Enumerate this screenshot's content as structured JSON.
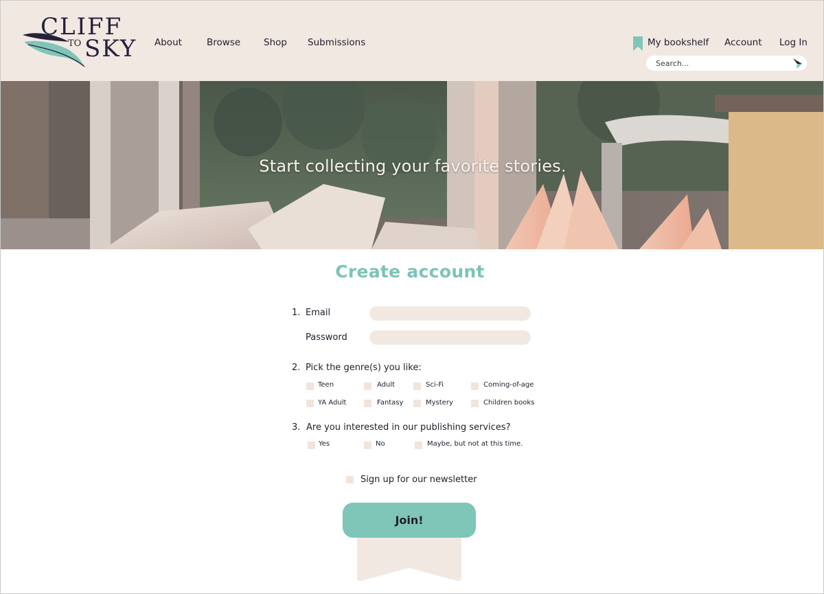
{
  "brand": {
    "line1": "CLIFF",
    "line2": "TO",
    "line3": "SKY"
  },
  "colors": {
    "header_bg": "#f2e8e2",
    "accent": "#7fc5b8",
    "title": "#7cc4b7",
    "field_bg": "#f2e8e2",
    "text": "#1e1e2c"
  },
  "nav": {
    "about": "About",
    "browse": "Browse",
    "shop": "Shop",
    "submissions": "Submissions"
  },
  "user_nav": {
    "bookshelf": "My bookshelf",
    "account": "Account",
    "login": "Log In",
    "bookshelf_icon": "bookmark-icon"
  },
  "search": {
    "placeholder": "Search...",
    "icon": "arrow-icon"
  },
  "hero": {
    "tagline": "Start collecting your favorite stories."
  },
  "form": {
    "title": "Create account",
    "step1_number": "1.",
    "email_label": "Email",
    "password_label": "Password",
    "step2_number": "2.",
    "genre_question": "Pick the genre(s) you like:",
    "genres": [
      "Teen",
      "Adult",
      "Sci-Fi",
      "Coming-of-age",
      "YA Adult",
      "Fantasy",
      "Mystery",
      "Children books"
    ],
    "step3_number": "3.",
    "publishing_question": "Are you interested in our publishing services?",
    "publishing_options": [
      "Yes",
      "No",
      "Maybe, but not at this time."
    ],
    "newsletter_label": "Sign up for our newsletter",
    "join_label": "Join!"
  }
}
